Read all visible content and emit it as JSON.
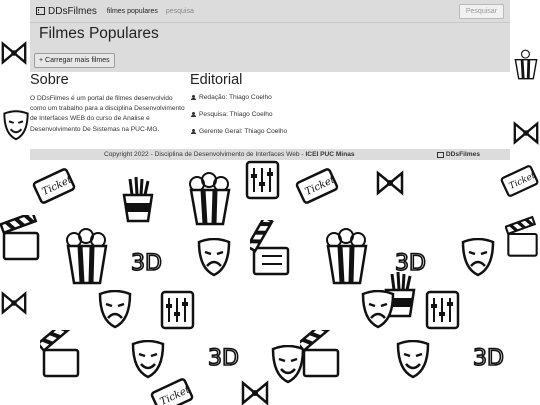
{
  "navbar": {
    "brand": "DDsFilmes",
    "links": [
      "filmes populares",
      "pesquisa"
    ],
    "search_button": "Pesquisar"
  },
  "header": {
    "title": "Filmes Populares",
    "load_more": "+ Carregar mais filmes"
  },
  "about": {
    "heading": "Sobre",
    "text": "O DDsFilmes é um portal de filmes desenvolvido como um trabalho para a disciplina Desenvolvimento de Interfaces WEB do curso de Analise e Desenvolvimento De Sistemas na PUC-MG."
  },
  "editorial": {
    "heading": "Editorial",
    "items": [
      "Redação: Thiago Coelho",
      "Pesquisa: Thiago Coelho",
      "Gerente Geral: Thiago Coelho"
    ]
  },
  "footer": {
    "copyright": "Copyright 2022 - Disciplina de Desenvolvimento de Interfaces Web - ",
    "institution": "ICEI PUC Minas",
    "brand": "DDsFilmes"
  }
}
